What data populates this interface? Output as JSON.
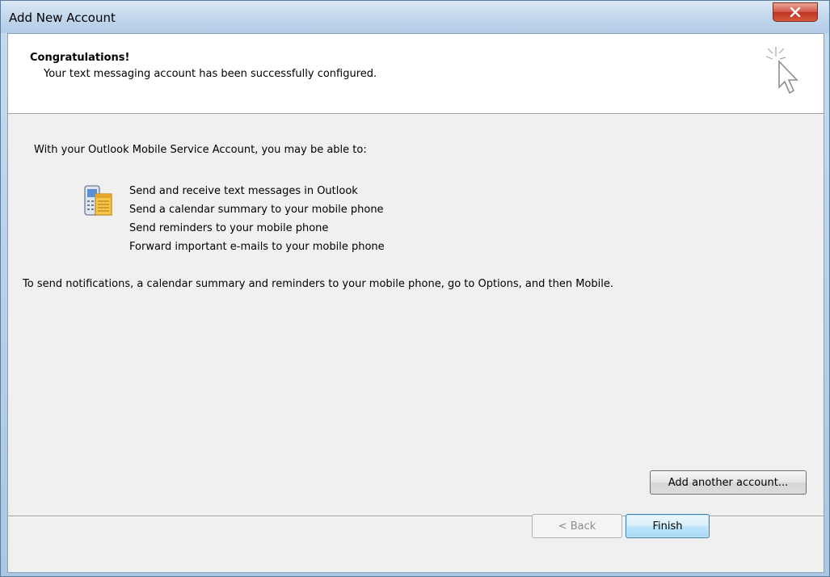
{
  "window": {
    "title": "Add New Account",
    "close_icon": "close-icon"
  },
  "header": {
    "title": "Congratulations!",
    "subtitle": "Your text messaging account has been successfully configured.",
    "icon": "wizard-cursor-icon"
  },
  "body": {
    "intro": "With your Outlook Mobile Service Account, you may be able to:",
    "icon": "mobile-phone-icon",
    "capabilities": [
      "Send and receive text messages in Outlook",
      "Send a calendar summary to your mobile phone",
      "Send reminders to your mobile phone",
      "Forward important e-mails to your mobile phone"
    ],
    "notification_text": "To send notifications, a calendar summary and reminders to your mobile phone, go to Options, and then Mobile."
  },
  "buttons": {
    "add_another": "Add another account...",
    "back": "< Back",
    "finish": "Finish"
  },
  "colors": {
    "accent": "#3c7fb1",
    "close_red": "#c7402e"
  }
}
